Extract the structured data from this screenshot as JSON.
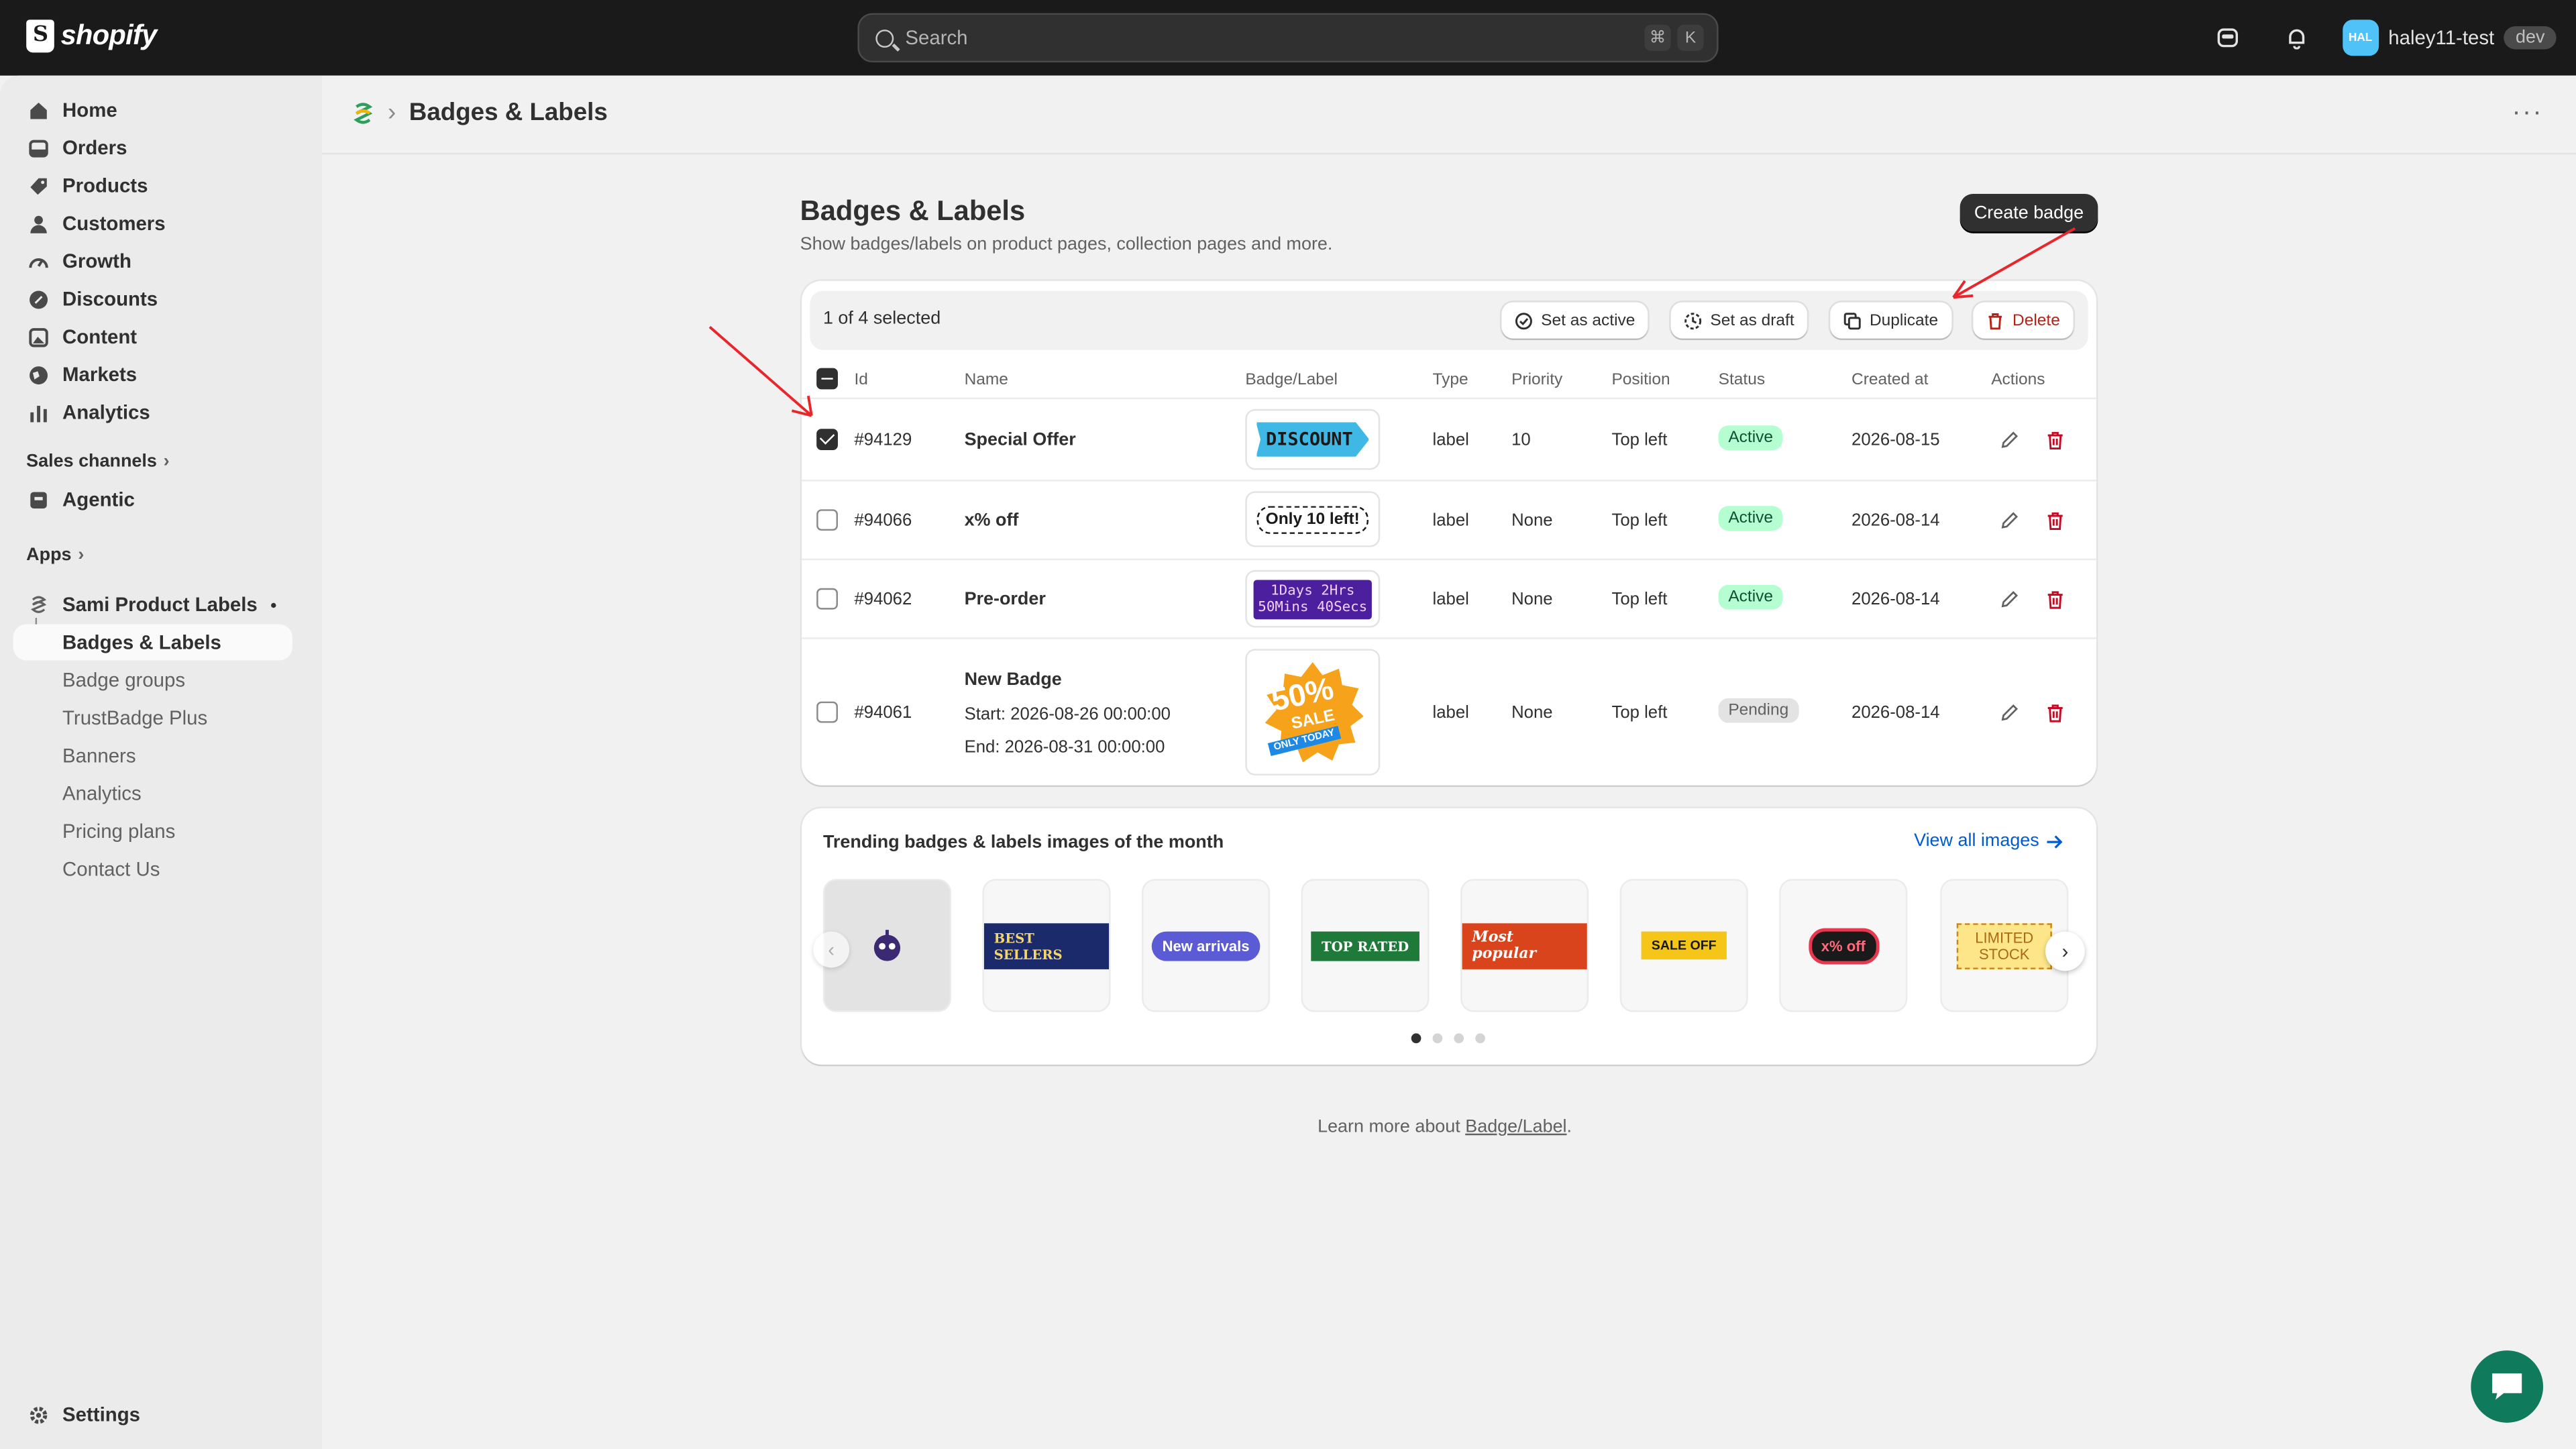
{
  "topbar": {
    "brand": "shopify",
    "search_placeholder": "Search",
    "kbd_1": "⌘",
    "kbd_2": "K",
    "avatar_initials": "HAL",
    "store_name": "haley11-test",
    "store_badge": "dev"
  },
  "sidebar": {
    "main": [
      {
        "label": "Home"
      },
      {
        "label": "Orders"
      },
      {
        "label": "Products"
      },
      {
        "label": "Customers"
      },
      {
        "label": "Growth"
      },
      {
        "label": "Discounts"
      },
      {
        "label": "Content"
      },
      {
        "label": "Markets"
      },
      {
        "label": "Analytics"
      }
    ],
    "sales_channels": "Sales channels",
    "agentic": "Agentic",
    "apps": "Apps",
    "app_name": "Sami Product Labels",
    "app_items": [
      {
        "label": "Badges & Labels"
      },
      {
        "label": "Badge groups"
      },
      {
        "label": "TrustBadge Plus"
      },
      {
        "label": "Banners"
      },
      {
        "label": "Analytics"
      },
      {
        "label": "Pricing plans"
      },
      {
        "label": "Contact Us"
      }
    ],
    "settings": "Settings"
  },
  "header": {
    "breadcrumb": "Badges & Labels"
  },
  "page": {
    "title": "Badges & Labels",
    "subtitle": "Show badges/labels on product pages, collection pages and more.",
    "create_button": "Create badge"
  },
  "bulk": {
    "selected_text": "1 of 4 selected",
    "set_active": "Set as active",
    "set_draft": "Set as draft",
    "duplicate": "Duplicate",
    "delete": "Delete"
  },
  "table": {
    "headers": {
      "id": "Id",
      "name": "Name",
      "badge": "Badge/Label",
      "type": "Type",
      "priority": "Priority",
      "position": "Position",
      "status": "Status",
      "created": "Created at",
      "actions": "Actions"
    },
    "rows": [
      {
        "id": "#94129",
        "name": "Special Offer",
        "badge_text": "DISCOUNT",
        "type": "label",
        "priority": "10",
        "position": "Top left",
        "status": "Active",
        "created": "2026-08-15",
        "checked": true
      },
      {
        "id": "#94066",
        "name": "x% off",
        "badge_text": "Only 10 left!",
        "type": "label",
        "priority": "None",
        "position": "Top left",
        "status": "Active",
        "created": "2026-08-14",
        "checked": false
      },
      {
        "id": "#94062",
        "name": "Pre-order",
        "badge_text_1": "1Days 2Hrs",
        "badge_text_2": "50Mins 40Secs",
        "type": "label",
        "priority": "None",
        "position": "Top left",
        "status": "Active",
        "created": "2026-08-14",
        "checked": false
      },
      {
        "id": "#94061",
        "name": "New Badge",
        "start": "Start: 2026-08-26 00:00:00",
        "end": "End: 2026-08-31 00:00:00",
        "badge_big": "50%",
        "badge_sale": "SALE",
        "badge_ribbon": "ONLY TODAY",
        "type": "label",
        "priority": "None",
        "position": "Top left",
        "status": "Pending",
        "created": "2026-08-14",
        "checked": false
      }
    ]
  },
  "trending": {
    "title": "Trending badges & labels images of the month",
    "view_all": "View all images",
    "tiles": [
      {
        "text": "",
        "icon": "robot-icon"
      },
      {
        "text": "BEST SELLERS",
        "color": "#1b2a6b"
      },
      {
        "text": "New arrivals",
        "color": "#5b5bd6"
      },
      {
        "text": "TOP RATED",
        "color": "#1f7a3a"
      },
      {
        "text": "Most popular",
        "color": "#d9441c"
      },
      {
        "text": "SALE OFF",
        "color": "#f5c518"
      },
      {
        "text": "x% off",
        "color": "#1a1a1a"
      },
      {
        "text_1": "LIMITED",
        "text_2": "STOCK",
        "color": "#fde68a"
      }
    ]
  },
  "footer": {
    "learn_prefix": "Learn more about ",
    "learn_link": "Badge/Label",
    "learn_suffix": "."
  }
}
